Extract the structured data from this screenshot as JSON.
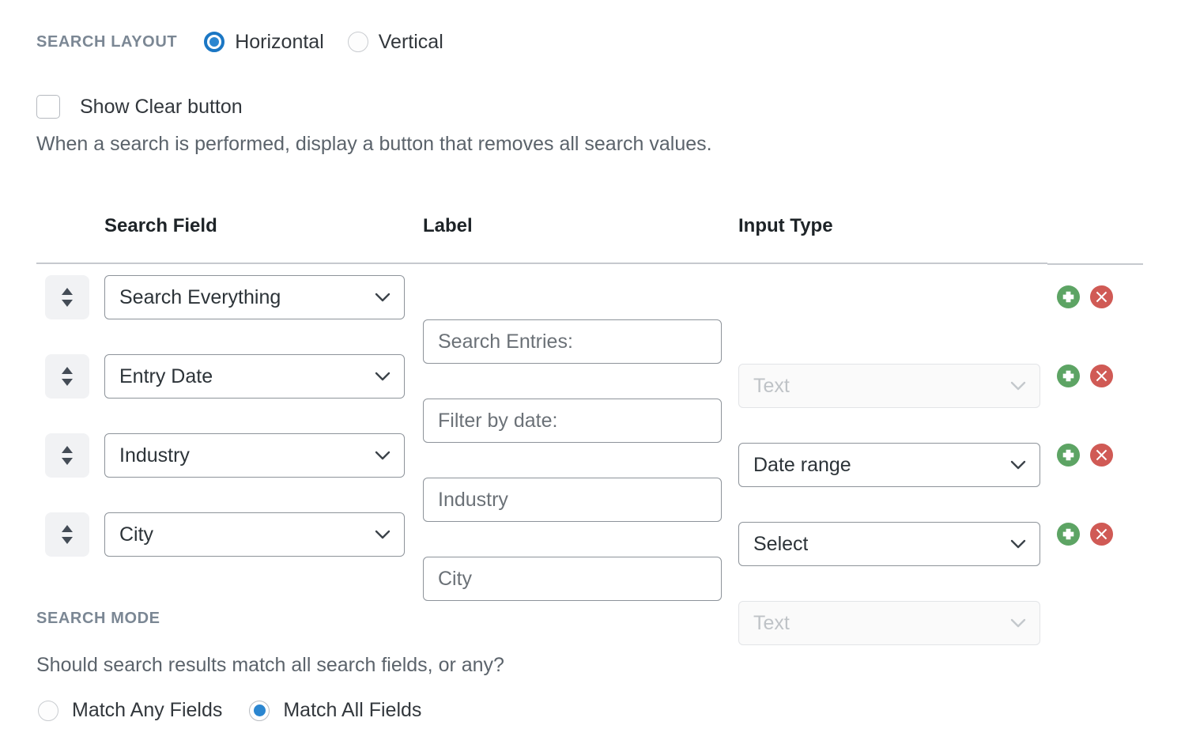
{
  "search_layout": {
    "label": "SEARCH LAYOUT",
    "options": [
      {
        "label": "Horizontal",
        "selected": true
      },
      {
        "label": "Vertical",
        "selected": false
      }
    ]
  },
  "clear_button": {
    "label": "Show Clear button",
    "checked": false,
    "description": "When a search is performed, display a button that removes all search values."
  },
  "table": {
    "headers": {
      "search_field": "Search Field",
      "label": "Label",
      "input_type": "Input Type"
    },
    "rows": [
      {
        "search_field": "Search Everything",
        "label": "Search Entries:",
        "input_type": "Text",
        "input_type_disabled": true
      },
      {
        "search_field": "Entry Date",
        "label": "Filter by date:",
        "input_type": "Date range",
        "input_type_disabled": false
      },
      {
        "search_field": "Industry",
        "label": "Industry",
        "input_type": "Select",
        "input_type_disabled": false
      },
      {
        "search_field": "City",
        "label": "City",
        "input_type": "Text",
        "input_type_disabled": true
      }
    ],
    "row_actions": {
      "add": "add-row",
      "remove": "remove-row",
      "drag": "reorder-row"
    }
  },
  "search_mode": {
    "label": "SEARCH MODE",
    "question": "Should search results match all search fields, or any?",
    "options": [
      {
        "label": "Match Any Fields",
        "selected": false
      },
      {
        "label": "Match All Fields",
        "selected": true
      }
    ]
  },
  "colors": {
    "accent_blue": "#2b86d0",
    "add_green": "#5da464",
    "remove_red": "#d05a55",
    "section_label": "#7b8794",
    "body_text": "#32373c",
    "muted_text": "#5b636b",
    "disabled_text": "#bfc3c7",
    "border": "#8d939a"
  }
}
